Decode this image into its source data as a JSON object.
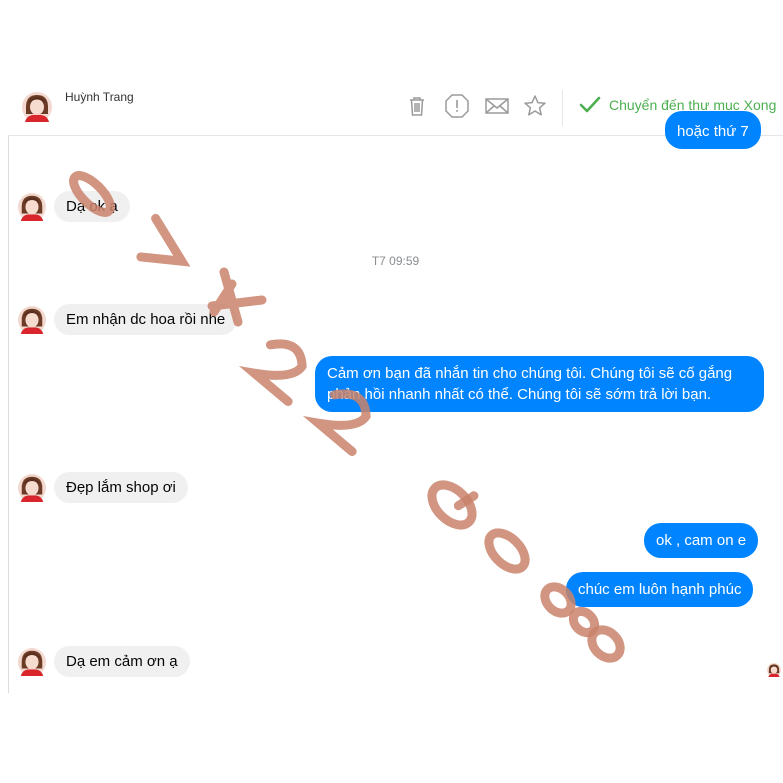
{
  "header": {
    "contact_name": "Huỳnh Trang",
    "tools": [
      "trash-icon",
      "report-icon",
      "mail-icon",
      "star-icon"
    ],
    "done_label": "Chuyển đến thư mục Xong"
  },
  "conversation": {
    "partial_top_message": "hoặc thứ 7",
    "timestamp": "T7 09:59",
    "messages": [
      {
        "dir": "in",
        "text": "Dạ ok ạ"
      },
      {
        "dir": "in",
        "text": "Em nhận dc hoa rồi nhe"
      },
      {
        "dir": "out",
        "text": "Cảm ơn bạn đã nhắn tin cho chúng tôi. Chúng tôi sẽ cố gắng phản hồi nhanh nhất có thể. Chúng tôi sẽ sớm trả lời bạn."
      },
      {
        "dir": "in",
        "text": "Đẹp lắm shop ơi"
      },
      {
        "dir": "out",
        "text": "ok , cam on e"
      },
      {
        "dir": "out",
        "text": "chúc em luôn hạnh phúc"
      },
      {
        "dir": "in",
        "text": "Dạ em cảm ơn ạ"
      }
    ]
  },
  "colors": {
    "outgoing": "#0084ff",
    "incoming": "#f0f0f0",
    "done": "#4caf50",
    "watermark": "#c9836b"
  },
  "watermark": {
    "text": "0 7 4 2 2 9 0 6 8",
    "kind": "diagonal watermark digits"
  }
}
